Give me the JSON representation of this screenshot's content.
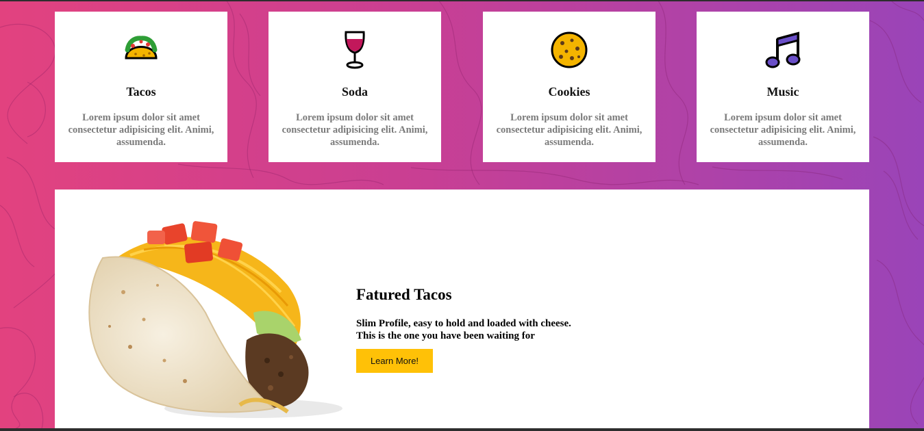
{
  "cards": [
    {
      "title": "Tacos",
      "text": "Lorem ipsum dolor sit amet consectetur adipisicing elit. Animi, assumenda.",
      "icon": "taco-icon"
    },
    {
      "title": "Soda",
      "text": "Lorem ipsum dolor sit amet consectetur adipisicing elit. Animi, assumenda.",
      "icon": "wine-glass-icon"
    },
    {
      "title": "Cookies",
      "text": "Lorem ipsum dolor sit amet consectetur adipisicing elit. Animi, assumenda.",
      "icon": "cookie-icon"
    },
    {
      "title": "Music",
      "text": "Lorem ipsum dolor sit amet consectetur adipisicing elit. Animi, assumenda.",
      "icon": "music-note-icon"
    }
  ],
  "featured": {
    "title": "Fatured Tacos",
    "line1": "Slim Profile, easy to hold and loaded with cheese.",
    "line2": "This is the one you have been waiting for",
    "button_label": "Learn More!",
    "image": "taco-photo"
  },
  "colors": {
    "gradient_start": "#e2427f",
    "gradient_end": "#9a44b8",
    "button": "#ffc107",
    "card_text": "#7a7a7a"
  }
}
